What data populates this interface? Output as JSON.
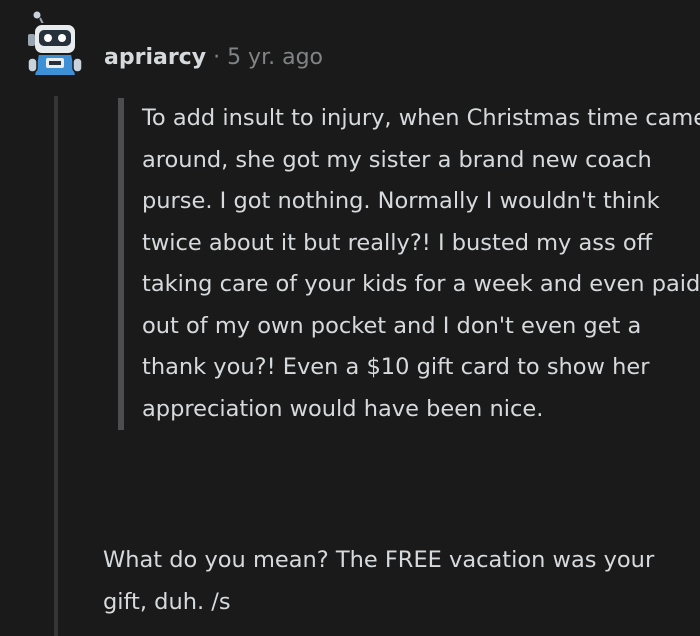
{
  "comment": {
    "author": "apriarcy",
    "separator": "·",
    "age": "5 yr. ago",
    "avatar_icon": "robot-avatar-icon",
    "quote_text": "To add insult to injury, when Christmas time came around, she got my sister a brand new coach purse. I got nothing. Normally I wouldn't think twice about it but really?! I busted my ass off taking care of your kids for a week and even paid out of my own pocket and I don't even get a thank you?! Even a $10 gift card to show her appreciation would have been nice.",
    "reply_text": "What do you mean? The FREE vacation was your gift, duh. /s"
  },
  "colors": {
    "background": "#1a1a1b",
    "text": "#d7dadc",
    "muted": "#818384",
    "thread_line": "#343536",
    "quote_border": "#4d4d4f"
  }
}
